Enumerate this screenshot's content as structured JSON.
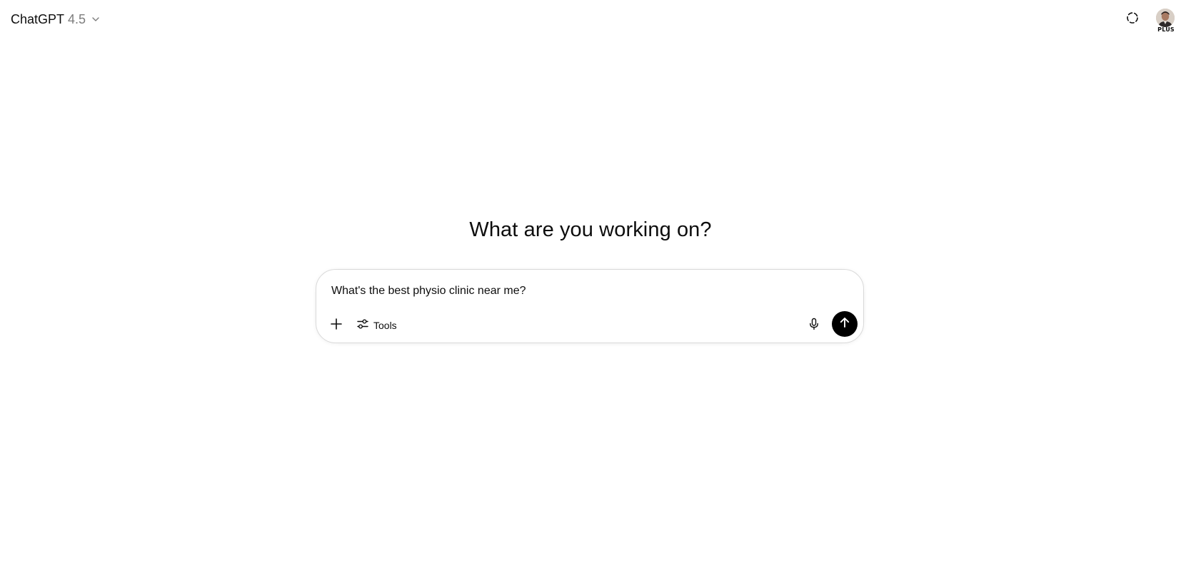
{
  "header": {
    "model_name": "ChatGPT",
    "model_version": "4.5",
    "chevron_icon": "chevron-down-icon",
    "temporary_chat_icon": "dashed-circle-icon",
    "plan_badge": "PLUS"
  },
  "main": {
    "headline": "What are you working on?",
    "composer": {
      "value": "What's the best physio clinic near me?",
      "tools_label": "Tools",
      "icons": {
        "add": "plus-icon",
        "tools": "sliders-icon",
        "mic": "microphone-icon",
        "send": "arrow-up-icon"
      }
    }
  },
  "colors": {
    "background": "#ffffff",
    "text": "#0d0d0d",
    "muted": "#7d7d7d",
    "border": "#d9d9d9",
    "send_button": "#000000"
  }
}
